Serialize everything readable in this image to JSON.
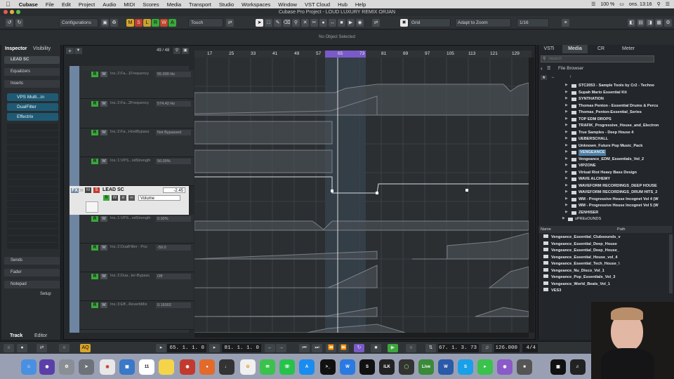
{
  "menubar": {
    "app": "Cubase",
    "items": [
      "File",
      "Edit",
      "Project",
      "Audio",
      "MIDI",
      "Scores",
      "Media",
      "Transport",
      "Studio",
      "Workspaces",
      "Window",
      "VST Cloud",
      "Hub",
      "Help"
    ],
    "battery": "100 %",
    "clock": "ons. 13:16"
  },
  "window_title": "Cubase Pro Project - LOUD LUXURY REMIX ORJAN",
  "toolbar": {
    "configurations": "Configurations",
    "mode_buttons": [
      "M",
      "S",
      "L",
      "R",
      "W",
      "A"
    ],
    "touch": "Touch",
    "grid": "Grid",
    "adapt": "Adapt to Zoom",
    "quantize": "1/16"
  },
  "status": "No Object Selected",
  "inspector": {
    "tabs": [
      "Inspector",
      "Visibility"
    ],
    "track": "LEAD SC",
    "equalizers": "Equalizers",
    "inserts": "Inserts",
    "plugins": [
      "VPS Multi...in",
      "DualFilter",
      "Effectrix"
    ],
    "sends": "Sends",
    "fader": "Fader",
    "notepad": "Notepad",
    "setup": "Setup",
    "bottom_tabs": [
      "Track",
      "Editor"
    ]
  },
  "project": {
    "zoom_readout": "49 / 48",
    "ruler": [
      "17",
      "25",
      "33",
      "41",
      "49",
      "57",
      "65",
      "73",
      "81",
      "89",
      "97",
      "105",
      "113",
      "121",
      "129"
    ],
    "lanes": [
      {
        "name": "Ins.:2:Fa...1Frequency",
        "value": "55.000 Hz"
      },
      {
        "name": "Ins.:2:Fa...2Frequency",
        "value": "574.42 Hz"
      },
      {
        "name": "Ins.:2:Fa...HostBypass",
        "value": "Not Bypassed"
      },
      {
        "name": "Ins.:1:VPS...ndStrength",
        "value": "50.00%"
      },
      {
        "name": "Ins.:1:VPS...ndStrength",
        "value": "0.00%"
      },
      {
        "name": "Ins.:2:DualFilter - Pos",
        "value": "-59.0"
      },
      {
        "name": "Ins.:2:Dua...ter-Bypass",
        "value": "Off"
      },
      {
        "name": "Ins.:3:Eff...ReverbMix",
        "value": "0.16002"
      }
    ],
    "selected_track": {
      "label": "FX",
      "index": "26",
      "name": "LEAD SC",
      "volume": "-2.45",
      "param": "Volume"
    }
  },
  "right_panel": {
    "tabs": [
      "VSTi",
      "Media",
      "CR",
      "Meter"
    ],
    "search_placeholder": "Search",
    "browser": "File Browser",
    "folders": [
      "STC2053 - Sample Tools by Cr2 - Techno",
      "Supah Mario Essential Kit",
      "SYNTHATION",
      "Thomas Penton - Essential Drums & Percu",
      "Thomas_Penton-Essential_Series",
      "TOP EDM DROPS",
      "TRAFIK_Progressive_House_and_Electron",
      "True Samples - Deep House 4",
      "UEBERSCHALL",
      "Unknown_Future Pop Music_Pack",
      "VENGEANCE",
      "Vengeance_EDM_Essentials_Vol_2",
      "VIPZONE",
      "Virtual Riot Heavy Bass Design",
      "WAVE ALCHEMY",
      "WAVEFORM RECORDINGS_DEEP HOUSE",
      "WAVEFORM RECORDINGS_DRUM HITS_2",
      "WM - Progressive House Incognet Vol 4 (W",
      "WM - Progressive House Incognet Vol 5 (W",
      "ZENHISER"
    ],
    "parent_folder": "sPREsOUNDS",
    "result_headers": [
      "Name",
      "Path"
    ],
    "results": [
      "Vengeance_Essential_Clubsounds_v",
      "Vengeance_Essential_Deep_House",
      "Vengeance_Essential_Deep_House_",
      "Vengeance_Essential_House_vol_4",
      "Vengeance_Essential_Tech_House_\\",
      "Vengeance_Nu_Disco_Vol_1",
      "Vengeance_Pop_Essentials_Vol_3",
      "Vengeance_World_Beats_Vol_1",
      "VES3"
    ]
  },
  "transport": {
    "left_locator": "65. 1. 1. 0",
    "right_locator": "81. 1. 1. 0",
    "position": "67. 1. 3. 73",
    "tempo": "126.000",
    "signature": "4/4"
  },
  "dock": {
    "calendar_day": "11",
    "apps": [
      "Finder",
      "Siri",
      "Preferences",
      "Launchpad",
      "Chrome",
      "Preview",
      "Calendar",
      "Notes",
      "Cubase",
      "iZotope",
      "Dorico",
      "Photos",
      "Messages",
      "WhatsApp",
      "App Store",
      "Terminal",
      "Waves",
      "Splice",
      "iLok",
      "Sync",
      "Live",
      "Word",
      "Skype",
      "FaceTime",
      "Notes2",
      "Screen",
      "Piano"
    ]
  },
  "colors": {
    "accent": "#1f5a74",
    "green": "#3aa83a",
    "cycle": "#7a5ac8",
    "selection": "#4b7fa6"
  }
}
